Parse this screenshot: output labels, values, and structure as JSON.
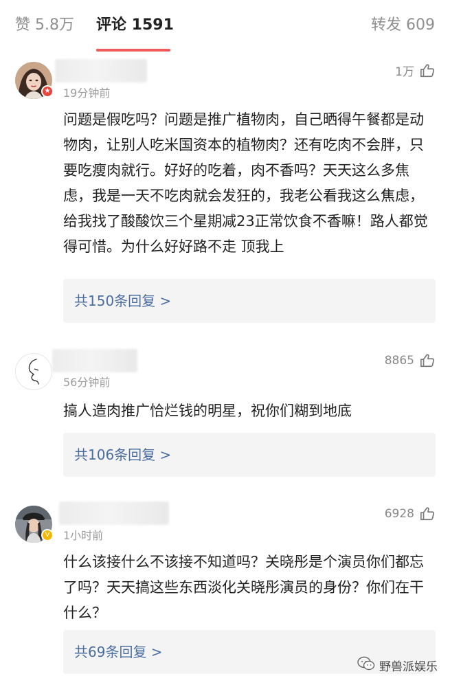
{
  "tabs": {
    "likes": "赞 5.8万",
    "comments": "评论 1591",
    "reposts": "转发 609"
  },
  "comments": [
    {
      "time": "19分钟前",
      "likes": "1万",
      "text": "问题是假吃吗？问题是推广植物肉，自己晒得午餐都是动物肉，让别人吃米国资本的植物肉？还有吃肉不会胖，只要吃瘦肉就行。好好的吃着，肉不香吗？天天这么多焦虑，我是一天不吃肉就会发狂的，我老公看我这么焦虑，给我找了酸酸饮三个星期减23正常饮食不香嘛！路人都觉得可惜。为什么好好路不走 顶我上",
      "replies": "共150条回复 >",
      "badge_color": "#e8453c"
    },
    {
      "time": "56分钟前",
      "likes": "8865",
      "text": "搞人造肉推广恰烂钱的明星，祝你们糊到地底",
      "replies": "共106条回复 >"
    },
    {
      "time": "1小时前",
      "likes": "6928",
      "text": "什么该接什么不该接不知道吗？关晓彤是个演员你们都忘了吗？天天搞这些东西淡化关晓彤演员的身份？你们在干什么？",
      "replies": "共69条回复 >",
      "badge_color": "#f5b800"
    }
  ],
  "watermark": {
    "text": "野兽派娱乐",
    "icon": "wechat-icon"
  },
  "colors": {
    "accent_underline": "#f05a5a",
    "link": "#4a6ea0",
    "reply_bg": "#f4f4f4"
  }
}
